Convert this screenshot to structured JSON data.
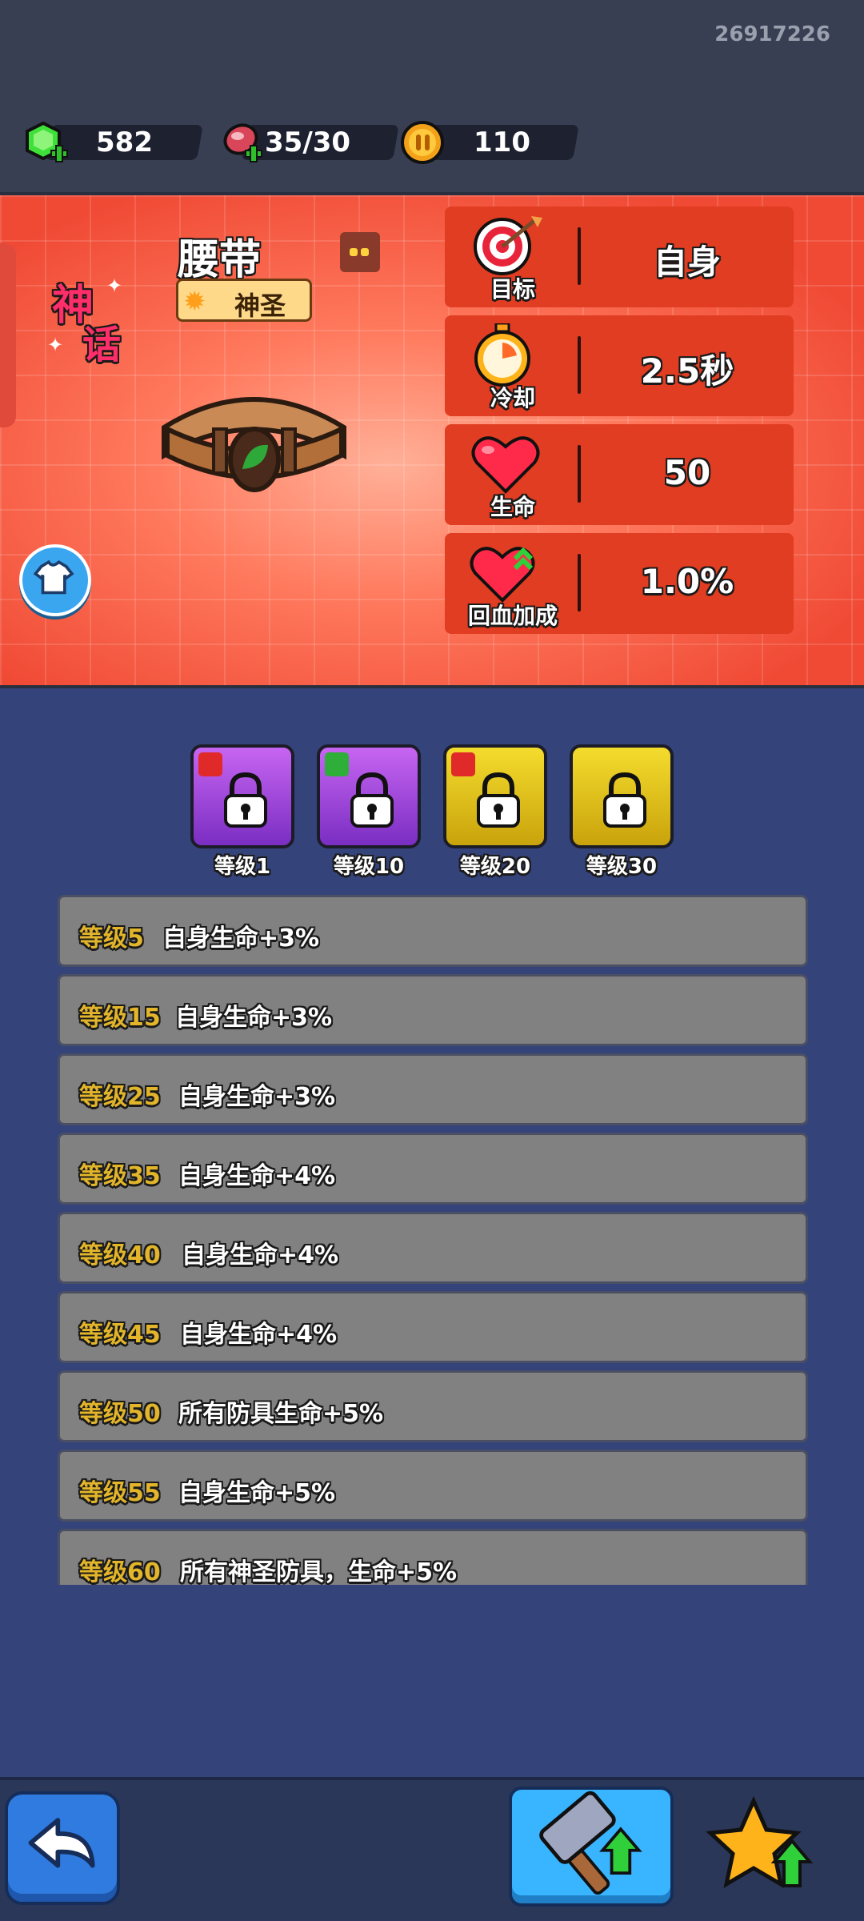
{
  "topbar": {
    "player_id": "26917226",
    "resources": [
      {
        "name": "gems",
        "value": "582"
      },
      {
        "name": "meat",
        "value": "35/30"
      },
      {
        "name": "coins",
        "value": "110"
      }
    ]
  },
  "item": {
    "badge": [
      "神",
      "话"
    ],
    "name": "腰带",
    "rarity": "神圣",
    "stats": [
      {
        "label": "目标",
        "value": "自身",
        "icon": "target-icon"
      },
      {
        "label": "冷却",
        "value": "2.5秒",
        "icon": "stopwatch-icon"
      },
      {
        "label": "生命",
        "value": "50",
        "icon": "heart-icon"
      },
      {
        "label": "回血加成",
        "value": "1.0%",
        "icon": "heart-regen-icon"
      }
    ]
  },
  "skills": [
    {
      "label": "等级1",
      "tier": "purple",
      "locked": true
    },
    {
      "label": "等级10",
      "tier": "purple",
      "locked": true
    },
    {
      "label": "等级20",
      "tier": "gold",
      "locked": true
    },
    {
      "label": "等级30",
      "tier": "gold",
      "locked": true
    }
  ],
  "perks": [
    {
      "level": "等级5",
      "desc": "自身生命+3%"
    },
    {
      "level": "等级15",
      "desc": "自身生命+3%"
    },
    {
      "level": "等级25",
      "desc": "自身生命+3%"
    },
    {
      "level": "等级35",
      "desc": "自身生命+4%"
    },
    {
      "level": "等级40",
      "desc": "自身生命+4%"
    },
    {
      "level": "等级45",
      "desc": "自身生命+4%"
    },
    {
      "level": "等级50",
      "desc": "所有防具生命+5%"
    },
    {
      "level": "等级55",
      "desc": "自身生命+5%"
    },
    {
      "level": "等级60",
      "desc": "所有神圣防具，生命+5%"
    }
  ],
  "colors": {
    "background": "#34437a",
    "banner": "#f04a35",
    "stat_box": "#e03d22",
    "perk_level": "#e2b52b",
    "perk_row": "#818181"
  }
}
